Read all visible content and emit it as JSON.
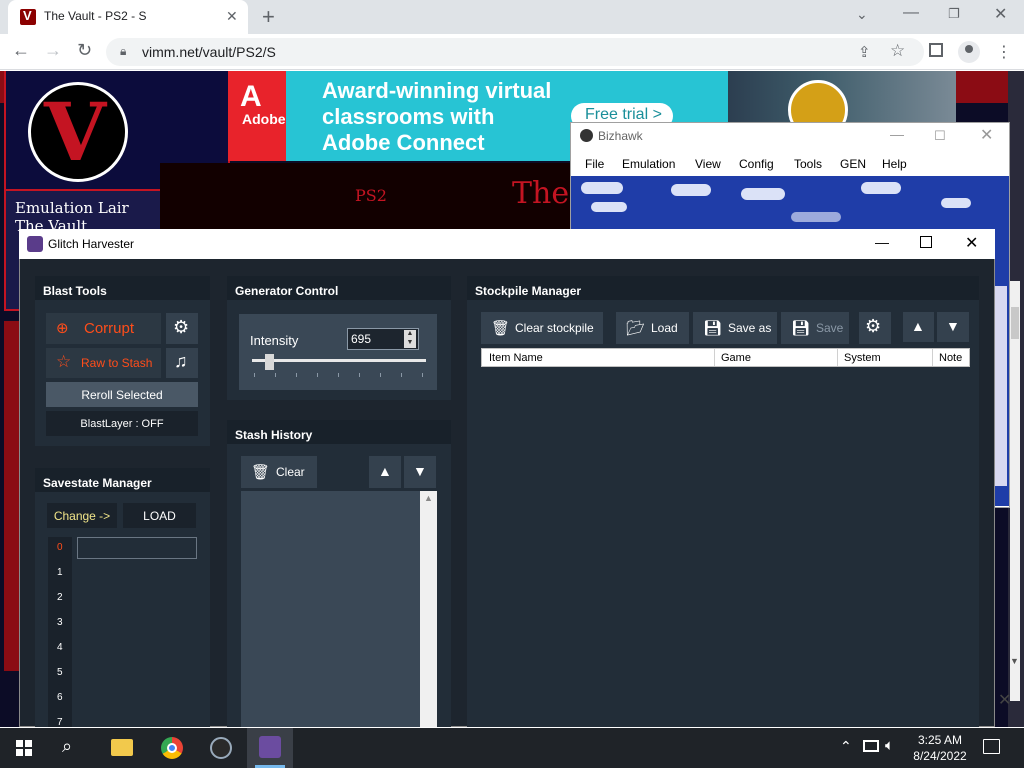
{
  "browser": {
    "tab_title": "The Vault - PS2 - S",
    "url": "vimm.net/vault/PS2/S"
  },
  "webpage": {
    "sidebar_title_1": "Emulation Lair",
    "sidebar_title_2": "The Vault",
    "banner_ps2": "PS2",
    "banner_the": "The"
  },
  "ad": {
    "brand": "Adobe",
    "headline": "Award-winning virtual classrooms with Adobe Connect",
    "cta": "Free trial >"
  },
  "bizhawk": {
    "title": "Bizhawk",
    "menu": [
      "File",
      "Emulation",
      "View",
      "Config",
      "Tools",
      "GEN",
      "Help"
    ]
  },
  "glitch_harvester": {
    "title": "Glitch Harvester",
    "blast_tools": {
      "header": "Blast Tools",
      "corrupt": "Corrupt",
      "raw_to_stash": "Raw to Stash",
      "reroll": "Reroll Selected",
      "blastlayer": "BlastLayer : OFF"
    },
    "generator": {
      "header": "Generator Control",
      "intensity_label": "Intensity",
      "intensity_value": "695",
      "slider_level": 0.1
    },
    "stash_history": {
      "header": "Stash History",
      "clear": "Clear"
    },
    "savestate": {
      "header": "Savestate Manager",
      "change": "Change ->",
      "load": "LOAD",
      "slots": [
        "0",
        "1",
        "2",
        "3",
        "4",
        "5",
        "6",
        "7"
      ]
    },
    "stockpile": {
      "header": "Stockpile Manager",
      "clear": "Clear stockpile",
      "load": "Load",
      "save_as": "Save as",
      "save": "Save",
      "columns": [
        "Item Name",
        "Game",
        "System",
        "Note"
      ]
    }
  },
  "taskbar": {
    "time": "3:25 AM",
    "date": "8/24/2022"
  }
}
